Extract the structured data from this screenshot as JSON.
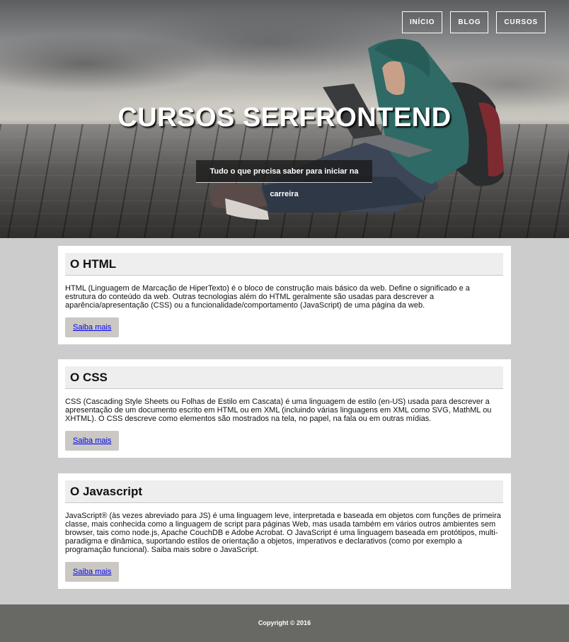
{
  "nav": {
    "items": [
      {
        "label": "INÍCIO"
      },
      {
        "label": "BLOG"
      },
      {
        "label": "CURSOS"
      }
    ]
  },
  "hero": {
    "title": "CURSOS SERFRONTEND",
    "subtitle": "Tudo o que precisa saber para iniciar na carreira"
  },
  "cards": [
    {
      "title": "O HTML",
      "text": "HTML (Linguagem de Marcação de HiperTexto) é o bloco de construção mais básico da web. Define o significado e a estrutura do conteúdo da web. Outras tecnologias além do HTML geralmente são usadas para descrever a aparência/apresentação (CSS) ou a funcionalidade/comportamento (JavaScript) de uma página da web.",
      "button": "Saiba mais"
    },
    {
      "title": "O CSS",
      "text": "CSS (Cascading Style Sheets ou Folhas de Estilo em Cascata) é uma linguagem de estilo (en-US) usada para descrever a apresentação de um documento escrito em HTML ou em XML (incluindo várias linguagens em XML como SVG, MathML ou XHTML). O CSS descreve como elementos são mostrados na tela, no papel, na fala ou em outras mídias.",
      "button": "Saiba mais"
    },
    {
      "title": "O Javascript",
      "text": "JavaScript® (às vezes abreviado para JS) é uma linguagem leve, interpretada e baseada em objetos com funções de primeira classe, mais conhecida como a linguagem de script para páginas Web, mas usada também em vários outros ambientes sem browser, tais como node.js, Apache CouchDB e Adobe Acrobat. O JavaScript é uma linguagem baseada em protótipos, multi-paradigma e dinâmica, suportando estilos de orientação a objetos, imperativos e declarativos (como por exemplo a programação funcional). Saiba mais sobre o JavaScript.",
      "button": "Saiba mais"
    }
  ],
  "footer": {
    "copyright": "Copyright © 2016"
  }
}
